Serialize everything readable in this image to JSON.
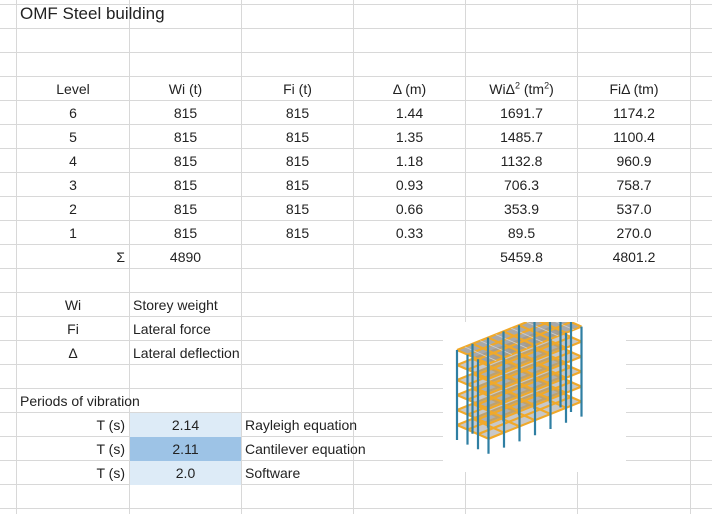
{
  "title": "OMF Steel building",
  "headers": {
    "level": "Level",
    "wi": "Wi (t)",
    "fi": "Fi (t)",
    "delta": "Δ (m)",
    "wid2_base": "WiΔ",
    "wid2_sup": "2",
    "wid2_unit_base": " (tm",
    "wid2_unit_sup": "2",
    "wid2_close": ")",
    "fid": "FiΔ (tm)"
  },
  "rows": [
    {
      "level": "6",
      "wi": "815",
      "fi": "815",
      "delta": "1.44",
      "wid2": "1691.7",
      "fid": "1174.2"
    },
    {
      "level": "5",
      "wi": "815",
      "fi": "815",
      "delta": "1.35",
      "wid2": "1485.7",
      "fid": "1100.4"
    },
    {
      "level": "4",
      "wi": "815",
      "fi": "815",
      "delta": "1.18",
      "wid2": "1132.8",
      "fid": "960.9"
    },
    {
      "level": "3",
      "wi": "815",
      "fi": "815",
      "delta": "0.93",
      "wid2": "706.3",
      "fid": "758.7"
    },
    {
      "level": "2",
      "wi": "815",
      "fi": "815",
      "delta": "0.66",
      "wid2": "353.9",
      "fid": "537.0"
    },
    {
      "level": "1",
      "wi": "815",
      "fi": "815",
      "delta": "0.33",
      "wid2": "89.5",
      "fid": "270.0"
    }
  ],
  "sum": {
    "symbol": "Σ",
    "wi": "4890",
    "wid2": "5459.8",
    "fid": "4801.2"
  },
  "legend": [
    {
      "sym": "Wi",
      "desc": "Storey weight"
    },
    {
      "sym": "Fi",
      "desc": "Lateral force"
    },
    {
      "sym": "Δ",
      "desc": "Lateral deflection"
    }
  ],
  "periods": {
    "title": "Periods of vibration",
    "rows": [
      {
        "label": "T (s)",
        "value": "2.14",
        "method": "Rayleigh equation"
      },
      {
        "label": "T (s)",
        "value": "2.11",
        "method": "Cantilever equation"
      },
      {
        "label": "T (s)",
        "value": "2.0",
        "method": "Software"
      }
    ]
  },
  "colors": {
    "grid": "#d8d8d8",
    "fill_light": "#ddebf7",
    "fill_dark": "#9dc3e6",
    "column": "#2f7fa3",
    "beam": "#f0a92a",
    "slab": "#9a9a9a"
  }
}
